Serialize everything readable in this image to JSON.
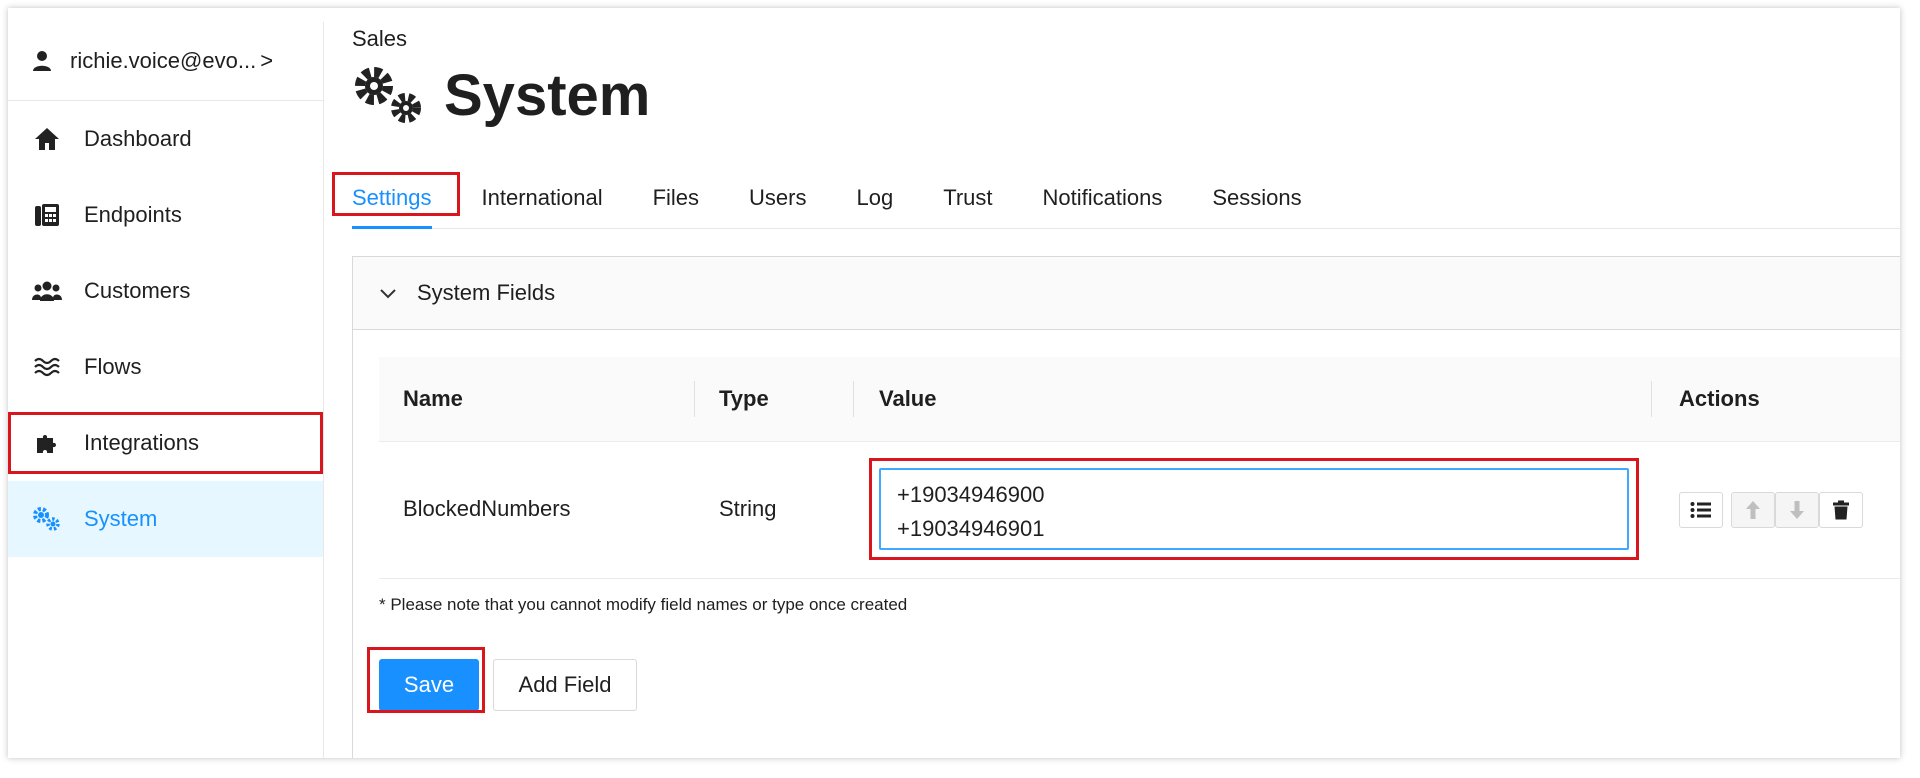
{
  "user": {
    "email": "richie.voice@evo...",
    "chevron": ">"
  },
  "sidebar": {
    "items": [
      {
        "label": "Dashboard",
        "icon": "home-icon"
      },
      {
        "label": "Endpoints",
        "icon": "phone-icon"
      },
      {
        "label": "Customers",
        "icon": "users-icon"
      },
      {
        "label": "Flows",
        "icon": "waves-icon"
      },
      {
        "label": "Integrations",
        "icon": "puzzle-icon"
      },
      {
        "label": "System",
        "icon": "gears-icon",
        "active": true
      }
    ]
  },
  "header": {
    "breadcrumb": "Sales",
    "title": "System"
  },
  "tabs": [
    "Settings",
    "International",
    "Files",
    "Users",
    "Log",
    "Trust",
    "Notifications",
    "Sessions"
  ],
  "panel": {
    "title": "System Fields",
    "columns": [
      "Name",
      "Type",
      "Value",
      "Actions"
    ],
    "rows": [
      {
        "name": "BlockedNumbers",
        "type": "String",
        "value": "+19034946900\n+19034946901"
      }
    ],
    "note": "* Please note that you cannot modify field names or type once created"
  },
  "buttons": {
    "save": "Save",
    "add_field": "Add Field"
  },
  "colors": {
    "accent": "#1890ff",
    "highlight": "#d9161e",
    "active_bg": "#e6f7ff"
  }
}
